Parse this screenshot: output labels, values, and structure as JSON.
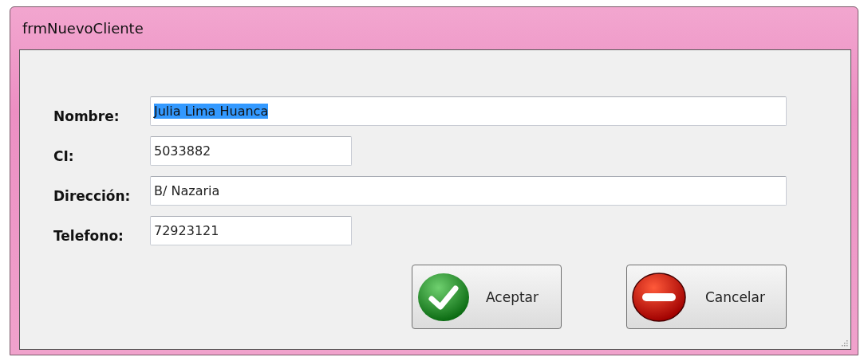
{
  "window": {
    "title": "frmNuevoCliente"
  },
  "fields": [
    {
      "label": "Nombre:",
      "value": "Julia Lima Huanca",
      "kind": "wide",
      "text_selected": true
    },
    {
      "label": "CI:",
      "value": "5033882",
      "kind": "short",
      "text_selected": false
    },
    {
      "label": "Dirección:",
      "value": "B/ Nazaria",
      "kind": "wide",
      "text_selected": false
    },
    {
      "label": "Telefono:",
      "value": "72923121",
      "kind": "short",
      "text_selected": false
    }
  ],
  "buttons": [
    {
      "label": "Aceptar",
      "kind": "ok"
    },
    {
      "label": "Cancelar",
      "kind": "cancel"
    }
  ]
}
